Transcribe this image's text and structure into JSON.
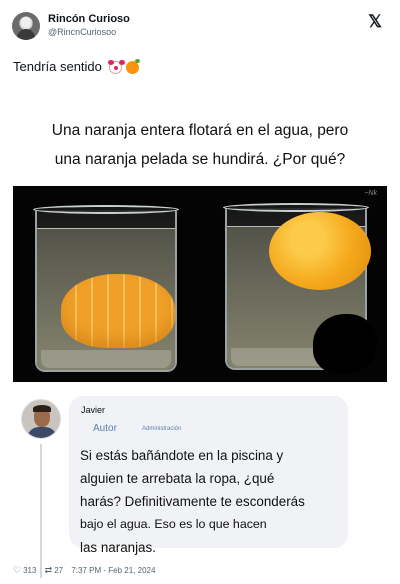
{
  "author": {
    "name": "Rincón Curioso",
    "handle": "@RincnCuriosoo"
  },
  "tweet": {
    "text": "Tendría sentido",
    "emojis": [
      "clown-face-icon",
      "orange-icon"
    ]
  },
  "meme": {
    "caption_line1": "Una naranja entera flotará en el agua, pero",
    "caption_line2": "una naranja pelada se hundirá. ¿Por qué?",
    "photo_signature": "~Nk"
  },
  "reply": {
    "name": "Javier",
    "role": "Autor",
    "badge": "Administración",
    "lines": [
      "Si estás bañándote en la piscina y",
      "alguien te arrebata la ropa, ¿qué",
      "harás? Definitivamente te esconderás",
      "bajo el agua. Eso es lo que hacen",
      "las naranjas."
    ]
  },
  "footer": {
    "likes": "313",
    "retweets": "27",
    "timestamp": "7:37 PM - Feb 21, 2024"
  },
  "colors": {
    "text": "#0f1419",
    "muted": "#536471",
    "bubble": "#f0f2f5",
    "link_blue": "#5a7fb0",
    "orange": "#f5a81c"
  }
}
